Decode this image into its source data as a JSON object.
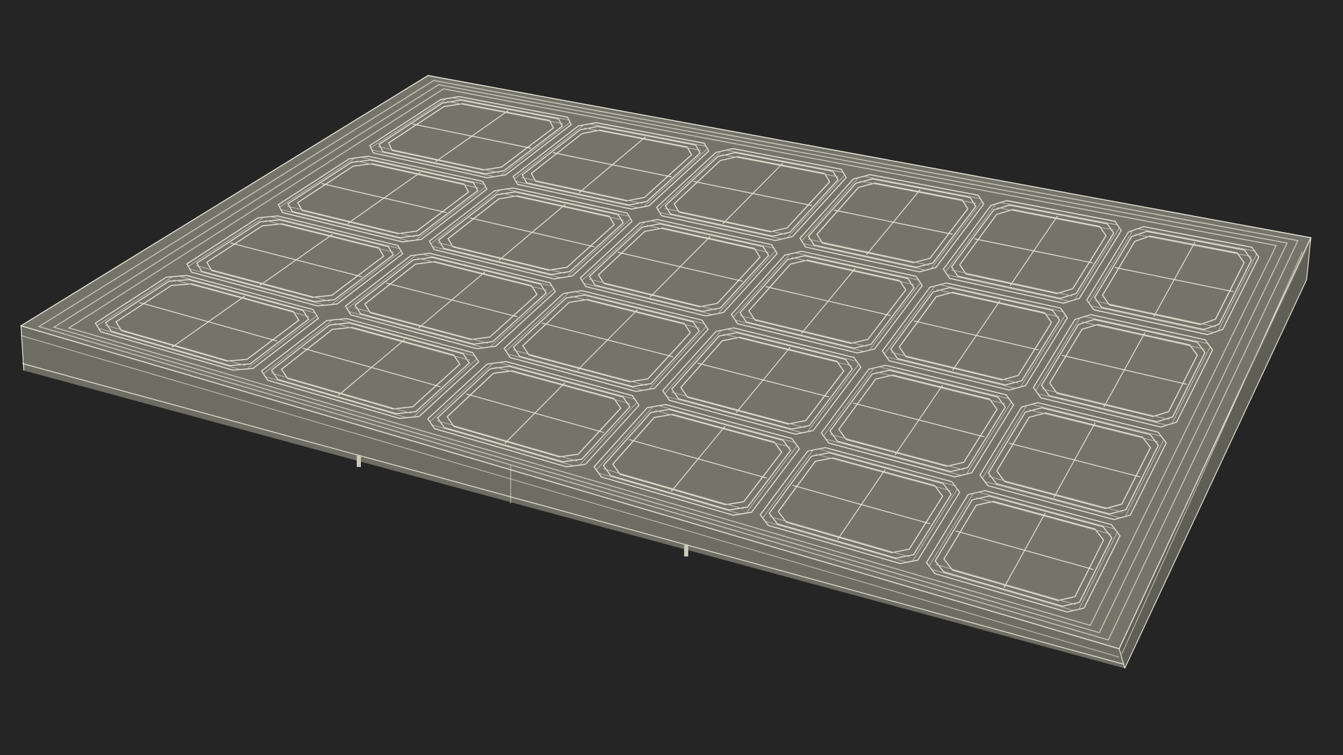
{
  "scene": {
    "subject": "wireframe-solar-panel",
    "colors": {
      "background": "#252525",
      "surface": "#74746a",
      "surface_dark": "#65655c",
      "side_front": "#6d6d63",
      "side_right": "#5f5f56",
      "wire": "#e7e7d8",
      "wire_dim": "#c9c9b8"
    },
    "grid": {
      "module_columns": 6,
      "module_rows": 4,
      "cells_per_module_side": 2
    }
  }
}
